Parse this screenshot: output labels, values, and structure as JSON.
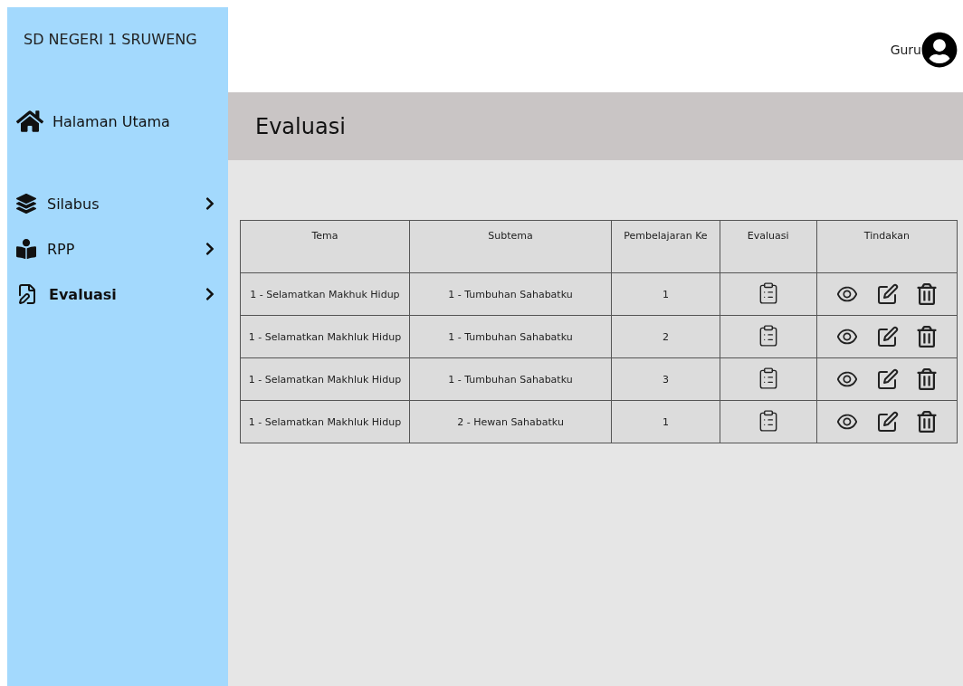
{
  "sidebar": {
    "school": "SD NEGERI 1 SRUWENG",
    "home": {
      "label": "Halaman Utama"
    },
    "items": [
      {
        "label": "Silabus",
        "kind": "silabus",
        "selected": false
      },
      {
        "label": "RPP",
        "kind": "rpp",
        "selected": false
      },
      {
        "label": "Evaluasi",
        "kind": "evaluasi",
        "selected": true
      }
    ]
  },
  "header": {
    "user": "Guru"
  },
  "page_title": "Evaluasi",
  "table": {
    "columns": [
      "Tema",
      "Subtema",
      "Pembelajaran Ke",
      "Evaluasi",
      "Tindakan"
    ],
    "rows": [
      {
        "tema": "1 - Selamatkan Makhuk Hidup",
        "subtema": "1 - Tumbuhan Sahabatku",
        "pembelajaran": "1"
      },
      {
        "tema": "1 - Selamatkan Makhluk Hidup",
        "subtema": "1 - Tumbuhan Sahabatku",
        "pembelajaran": "2"
      },
      {
        "tema": "1 - Selamatkan Makhluk Hidup",
        "subtema": "1 - Tumbuhan Sahabatku",
        "pembelajaran": "3"
      },
      {
        "tema": "1 - Selamatkan Makhluk Hidup",
        "subtema": "2 - Hewan Sahabatku",
        "pembelajaran": "1"
      }
    ]
  }
}
